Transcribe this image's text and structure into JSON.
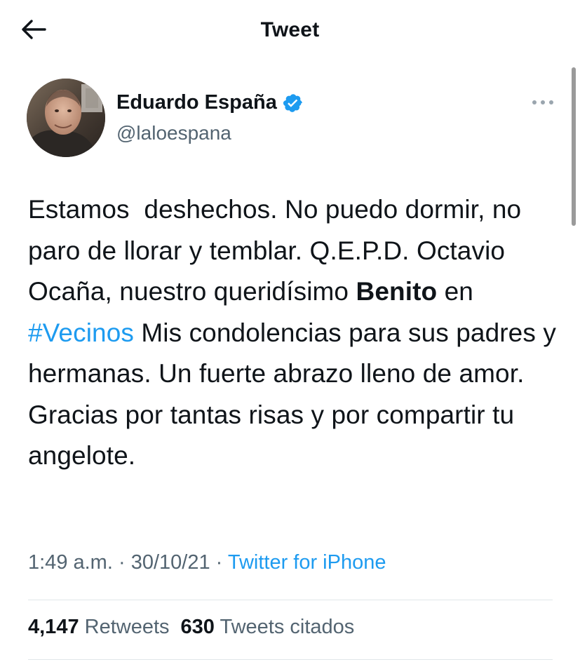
{
  "header": {
    "title": "Tweet",
    "back_icon": "arrow-left-icon"
  },
  "author": {
    "display_name": "Eduardo España",
    "handle": "@laloespana",
    "verified_icon": "verified-badge-icon",
    "more_icon": "more-horizontal-icon"
  },
  "tweet": {
    "text_1": "Estamos  deshechos. No puedo dormir, no paro de llorar y temblar. Q.E.P.D. Octavio Ocaña, nuestro queridísimo ",
    "bold": "Benito",
    "text_2": " en ",
    "hashtag": "#Vecinos",
    "text_3": " Mis condolencias para sus padres y hermanas. Un fuerte abrazo lleno de amor. Gracias por tantas risas y por compartir tu angelote."
  },
  "meta": {
    "time": "1:49 a.m.",
    "sep1": " · ",
    "date": "30/10/21",
    "sep2": " · ",
    "source": "Twitter for iPhone"
  },
  "stats": {
    "retweets_count": "4,147",
    "retweets_label": "Retweets",
    "quotes_count": "630",
    "quotes_label": "Tweets citados"
  },
  "colors": {
    "accent": "#1d9bf0",
    "secondary_text": "#536471",
    "primary_text": "#0f1419"
  }
}
